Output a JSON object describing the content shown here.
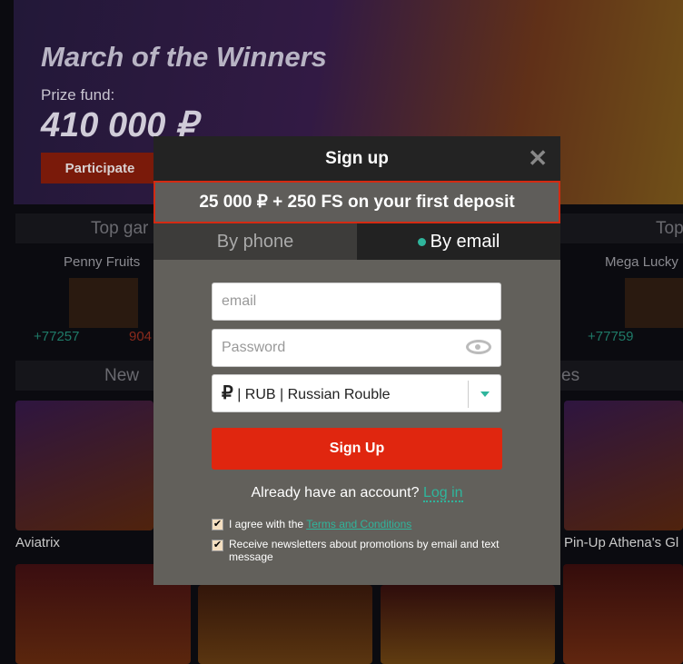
{
  "banner": {
    "title": "March of the Winners",
    "prize_label": "Prize fund:",
    "prize_amount": "410 000 ₽",
    "participate": "Participate"
  },
  "sections": {
    "top_left": "Top gar",
    "top_right": "Top",
    "new": "New",
    "right_partial": "es"
  },
  "top_games": [
    {
      "name": "Penny Fruits",
      "win": "+77257",
      "loss": "904"
    },
    {
      "name": "Mega Lucky",
      "win": "+77759"
    }
  ],
  "tiles": [
    {
      "label": "Aviatrix"
    },
    {
      "label": "Pin-Up Athena's Gl"
    }
  ],
  "modal": {
    "title": "Sign up",
    "promo": "25 000 ₽ + 250 FS on your first deposit",
    "tabs": [
      {
        "label": "By phone",
        "active": false
      },
      {
        "label": "By email",
        "active": true
      }
    ],
    "email_placeholder": "email",
    "password_placeholder": "Password",
    "currency_symbol": "₽",
    "currency": "| RUB | Russian Rouble",
    "submit": "Sign Up",
    "have_account": "Already have an account?",
    "login": "Log in",
    "agree_prefix": "I agree with the",
    "terms": "Terms and Conditions",
    "newsletter": "Receive newsletters about promotions by email and text message",
    "agree_checked": true,
    "newsletter_checked": true
  },
  "colors": {
    "accent": "#2fb59c",
    "primary": "#e0260f"
  }
}
